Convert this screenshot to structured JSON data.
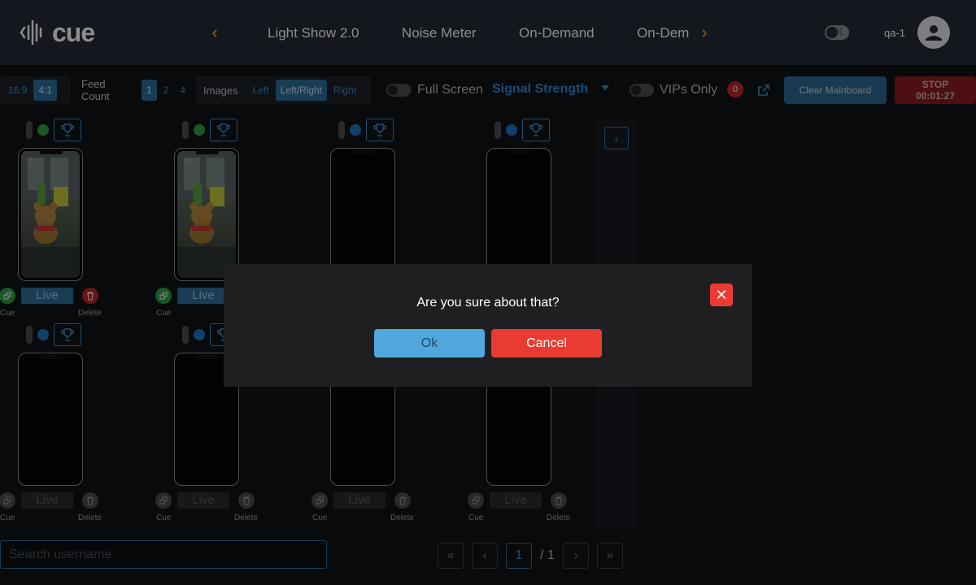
{
  "header": {
    "logo_text": "cue",
    "tabs": [
      "Light Show 2.0",
      "Noise Meter",
      "On-Demand",
      "On-Dem"
    ],
    "username": "qa-1"
  },
  "toolbar": {
    "ratio_options": [
      "16:9",
      "4:1"
    ],
    "ratio_selected": "4:1",
    "feed_count_label": "Feed Count",
    "feed_count_options": [
      "1",
      "2",
      "4"
    ],
    "feed_count_selected": "1",
    "images_label": "Images",
    "image_options": [
      "Left",
      "Left/Right",
      "Right"
    ],
    "image_selected": "Left/Right",
    "full_screen_label": "Full Screen",
    "signal_select": "Signal Strength",
    "vips_only_label": "VIPs Only",
    "vip_count": "0",
    "clear_label": "Clear Mainboard",
    "stop_label": "STOP",
    "stop_timer": "00:01:27"
  },
  "cards": {
    "live_label": "Live",
    "cue_label": "Cue",
    "delete_label": "Delete"
  },
  "footer": {
    "search_placeholder": "Search username",
    "current_page": "1",
    "total_pages": "/ 1"
  },
  "modal": {
    "message": "Are you sure about that?",
    "ok_label": "Ok",
    "cancel_label": "Cancel"
  },
  "colors": {
    "accent": "#3b8fc9",
    "danger": "#ea3b33",
    "online": "#2ea043",
    "offline": "#1f77c2"
  }
}
